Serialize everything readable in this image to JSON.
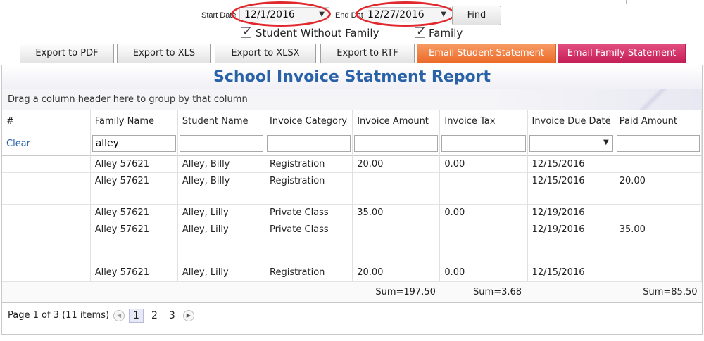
{
  "filters": {
    "start_label": "Start Date",
    "start_value": "12/1/2016",
    "end_label": "End Date",
    "end_value": "12/27/2016",
    "find_label": "Find",
    "student_without_family_label": "Student Without Family",
    "family_label": "Family"
  },
  "export_buttons": {
    "pdf": "Export to PDF",
    "xls": "Export to XLS",
    "xlsx": "Export to XLSX",
    "rtf": "Export to RTF",
    "email_student": "Email Student Statement",
    "email_family": "Email Family Statement"
  },
  "grid": {
    "title": "School Invoice Statment Report",
    "group_hint": "Drag a column header here to group by that column",
    "columns": [
      "#",
      "Family Name",
      "Student Name",
      "Invoice Category",
      "Invoice Amount",
      "Invoice Tax",
      "Invoice Due Date",
      "Paid Amount"
    ],
    "clear_label": "Clear",
    "family_filter_value": "alley",
    "rows": [
      {
        "family": "Alley 57621",
        "student": "Alley, Billy",
        "category": "Registration",
        "amount": "20.00",
        "tax": "0.00",
        "due": "12/15/2016",
        "paid": ""
      },
      {
        "family": "Alley 57621",
        "student": "Alley, Billy",
        "category": "Registration",
        "amount": "",
        "tax": "",
        "due": "12/15/2016",
        "paid": "20.00"
      },
      {
        "family": "Alley 57621",
        "student": "Alley, Lilly",
        "category": "Private Class",
        "amount": "35.00",
        "tax": "0.00",
        "due": "12/19/2016",
        "paid": ""
      },
      {
        "family": "Alley 57621",
        "student": "Alley, Lilly",
        "category": "Private Class",
        "amount": "",
        "tax": "",
        "due": "12/19/2016",
        "paid": "35.00"
      },
      {
        "family": "Alley 57621",
        "student": "Alley, Lilly",
        "category": "Registration",
        "amount": "20.00",
        "tax": "0.00",
        "due": "12/15/2016",
        "paid": ""
      }
    ],
    "sums": {
      "amount": "Sum=197.50",
      "tax": "Sum=3.68",
      "paid": "Sum=85.50"
    }
  },
  "pager": {
    "summary": "Page 1 of 3 (11 items)",
    "pages": [
      "1",
      "2",
      "3"
    ]
  }
}
